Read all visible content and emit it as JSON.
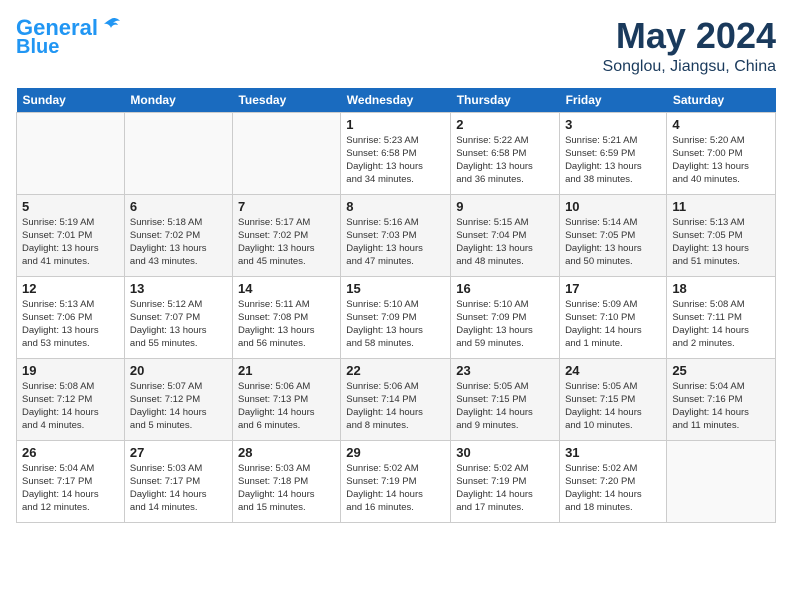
{
  "header": {
    "logo_line1": "General",
    "logo_line2": "Blue",
    "month_year": "May 2024",
    "location": "Songlou, Jiangsu, China"
  },
  "weekdays": [
    "Sunday",
    "Monday",
    "Tuesday",
    "Wednesday",
    "Thursday",
    "Friday",
    "Saturday"
  ],
  "weeks": [
    [
      {
        "day": "",
        "info": ""
      },
      {
        "day": "",
        "info": ""
      },
      {
        "day": "",
        "info": ""
      },
      {
        "day": "1",
        "info": "Sunrise: 5:23 AM\nSunset: 6:58 PM\nDaylight: 13 hours\nand 34 minutes."
      },
      {
        "day": "2",
        "info": "Sunrise: 5:22 AM\nSunset: 6:58 PM\nDaylight: 13 hours\nand 36 minutes."
      },
      {
        "day": "3",
        "info": "Sunrise: 5:21 AM\nSunset: 6:59 PM\nDaylight: 13 hours\nand 38 minutes."
      },
      {
        "day": "4",
        "info": "Sunrise: 5:20 AM\nSunset: 7:00 PM\nDaylight: 13 hours\nand 40 minutes."
      }
    ],
    [
      {
        "day": "5",
        "info": "Sunrise: 5:19 AM\nSunset: 7:01 PM\nDaylight: 13 hours\nand 41 minutes."
      },
      {
        "day": "6",
        "info": "Sunrise: 5:18 AM\nSunset: 7:02 PM\nDaylight: 13 hours\nand 43 minutes."
      },
      {
        "day": "7",
        "info": "Sunrise: 5:17 AM\nSunset: 7:02 PM\nDaylight: 13 hours\nand 45 minutes."
      },
      {
        "day": "8",
        "info": "Sunrise: 5:16 AM\nSunset: 7:03 PM\nDaylight: 13 hours\nand 47 minutes."
      },
      {
        "day": "9",
        "info": "Sunrise: 5:15 AM\nSunset: 7:04 PM\nDaylight: 13 hours\nand 48 minutes."
      },
      {
        "day": "10",
        "info": "Sunrise: 5:14 AM\nSunset: 7:05 PM\nDaylight: 13 hours\nand 50 minutes."
      },
      {
        "day": "11",
        "info": "Sunrise: 5:13 AM\nSunset: 7:05 PM\nDaylight: 13 hours\nand 51 minutes."
      }
    ],
    [
      {
        "day": "12",
        "info": "Sunrise: 5:13 AM\nSunset: 7:06 PM\nDaylight: 13 hours\nand 53 minutes."
      },
      {
        "day": "13",
        "info": "Sunrise: 5:12 AM\nSunset: 7:07 PM\nDaylight: 13 hours\nand 55 minutes."
      },
      {
        "day": "14",
        "info": "Sunrise: 5:11 AM\nSunset: 7:08 PM\nDaylight: 13 hours\nand 56 minutes."
      },
      {
        "day": "15",
        "info": "Sunrise: 5:10 AM\nSunset: 7:09 PM\nDaylight: 13 hours\nand 58 minutes."
      },
      {
        "day": "16",
        "info": "Sunrise: 5:10 AM\nSunset: 7:09 PM\nDaylight: 13 hours\nand 59 minutes."
      },
      {
        "day": "17",
        "info": "Sunrise: 5:09 AM\nSunset: 7:10 PM\nDaylight: 14 hours\nand 1 minute."
      },
      {
        "day": "18",
        "info": "Sunrise: 5:08 AM\nSunset: 7:11 PM\nDaylight: 14 hours\nand 2 minutes."
      }
    ],
    [
      {
        "day": "19",
        "info": "Sunrise: 5:08 AM\nSunset: 7:12 PM\nDaylight: 14 hours\nand 4 minutes."
      },
      {
        "day": "20",
        "info": "Sunrise: 5:07 AM\nSunset: 7:12 PM\nDaylight: 14 hours\nand 5 minutes."
      },
      {
        "day": "21",
        "info": "Sunrise: 5:06 AM\nSunset: 7:13 PM\nDaylight: 14 hours\nand 6 minutes."
      },
      {
        "day": "22",
        "info": "Sunrise: 5:06 AM\nSunset: 7:14 PM\nDaylight: 14 hours\nand 8 minutes."
      },
      {
        "day": "23",
        "info": "Sunrise: 5:05 AM\nSunset: 7:15 PM\nDaylight: 14 hours\nand 9 minutes."
      },
      {
        "day": "24",
        "info": "Sunrise: 5:05 AM\nSunset: 7:15 PM\nDaylight: 14 hours\nand 10 minutes."
      },
      {
        "day": "25",
        "info": "Sunrise: 5:04 AM\nSunset: 7:16 PM\nDaylight: 14 hours\nand 11 minutes."
      }
    ],
    [
      {
        "day": "26",
        "info": "Sunrise: 5:04 AM\nSunset: 7:17 PM\nDaylight: 14 hours\nand 12 minutes."
      },
      {
        "day": "27",
        "info": "Sunrise: 5:03 AM\nSunset: 7:17 PM\nDaylight: 14 hours\nand 14 minutes."
      },
      {
        "day": "28",
        "info": "Sunrise: 5:03 AM\nSunset: 7:18 PM\nDaylight: 14 hours\nand 15 minutes."
      },
      {
        "day": "29",
        "info": "Sunrise: 5:02 AM\nSunset: 7:19 PM\nDaylight: 14 hours\nand 16 minutes."
      },
      {
        "day": "30",
        "info": "Sunrise: 5:02 AM\nSunset: 7:19 PM\nDaylight: 14 hours\nand 17 minutes."
      },
      {
        "day": "31",
        "info": "Sunrise: 5:02 AM\nSunset: 7:20 PM\nDaylight: 14 hours\nand 18 minutes."
      },
      {
        "day": "",
        "info": ""
      }
    ]
  ]
}
